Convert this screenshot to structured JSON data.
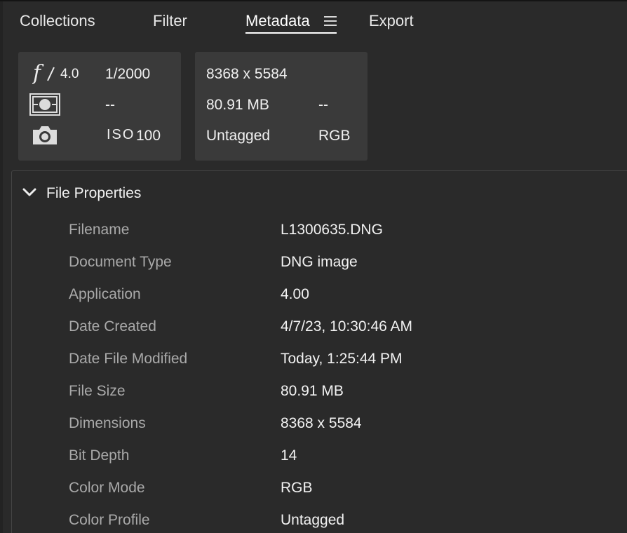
{
  "tabs": [
    {
      "label": "Collections"
    },
    {
      "label": "Filter"
    },
    {
      "label": "Metadata"
    },
    {
      "label": "Export"
    }
  ],
  "active_tab": "Metadata",
  "exposure_card": {
    "aperture": "4.0",
    "shutter": "1/2000",
    "metering": "--",
    "iso_label": "ISO",
    "iso_value": "100",
    "icons": [
      "aperture-f-icon",
      "metering-mode-icon",
      "camera-icon"
    ]
  },
  "file_card": {
    "dimensions": "8368 x 5584",
    "size": "80.91 MB",
    "size_extra": "--",
    "profile": "Untagged",
    "mode": "RGB"
  },
  "file_properties": {
    "title": "File Properties",
    "rows": [
      {
        "label": "Filename",
        "value": "L1300635.DNG"
      },
      {
        "label": "Document Type",
        "value": "DNG image"
      },
      {
        "label": "Application",
        "value": "4.00"
      },
      {
        "label": "Date Created",
        "value": "4/7/23, 10:30:46 AM"
      },
      {
        "label": "Date File Modified",
        "value": "Today, 1:25:44 PM"
      },
      {
        "label": "File Size",
        "value": "80.91 MB"
      },
      {
        "label": "Dimensions",
        "value": "8368 x 5584"
      },
      {
        "label": "Bit Depth",
        "value": "14"
      },
      {
        "label": "Color Mode",
        "value": "RGB"
      },
      {
        "label": "Color Profile",
        "value": "Untagged"
      }
    ]
  },
  "colors": {
    "background": "#2a2a2a",
    "card": "#3a3a3a",
    "label": "#a9a9a9",
    "value": "#f2f2f2"
  }
}
